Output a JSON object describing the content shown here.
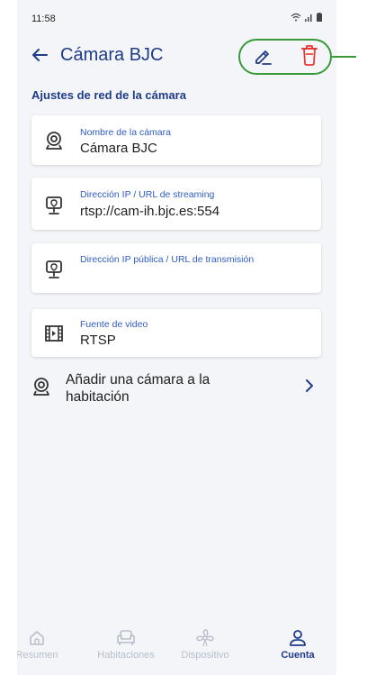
{
  "status_bar": {
    "time": "11:58"
  },
  "header": {
    "title": "Cámara BJC"
  },
  "section": {
    "title": "Ajustes de red de la cámara"
  },
  "fields": [
    {
      "icon": "webcam-icon",
      "label": "Nombre de la cámara",
      "value": "Cámara BJC"
    },
    {
      "icon": "ip-camera-pin-icon",
      "label": "Dirección IP / URL de streaming",
      "value": "rtsp://cam-ih.bjc.es:554"
    },
    {
      "icon": "ip-camera-pin-icon",
      "label": "Dirección IP pública / URL de transmisión",
      "value": ""
    },
    {
      "icon": "film-icon",
      "label": "Fuente de video",
      "value": "RTSP"
    }
  ],
  "add_room": {
    "label": "Añadir una cámara a la habitación"
  },
  "bottom_nav": [
    {
      "label": "Resumen",
      "icon": "home-icon",
      "active": false
    },
    {
      "label": "Habitaciones",
      "icon": "armchair-icon",
      "active": false
    },
    {
      "label": "Dispositivo",
      "icon": "fan-icon",
      "active": false
    },
    {
      "label": "Cuenta",
      "icon": "user-icon",
      "active": true
    }
  ],
  "colors": {
    "primary": "#1f3b8a",
    "accent_label": "#2f5cc4",
    "delete": "#e53935",
    "highlight": "#3a9a3a",
    "background": "#f3f5f8"
  }
}
